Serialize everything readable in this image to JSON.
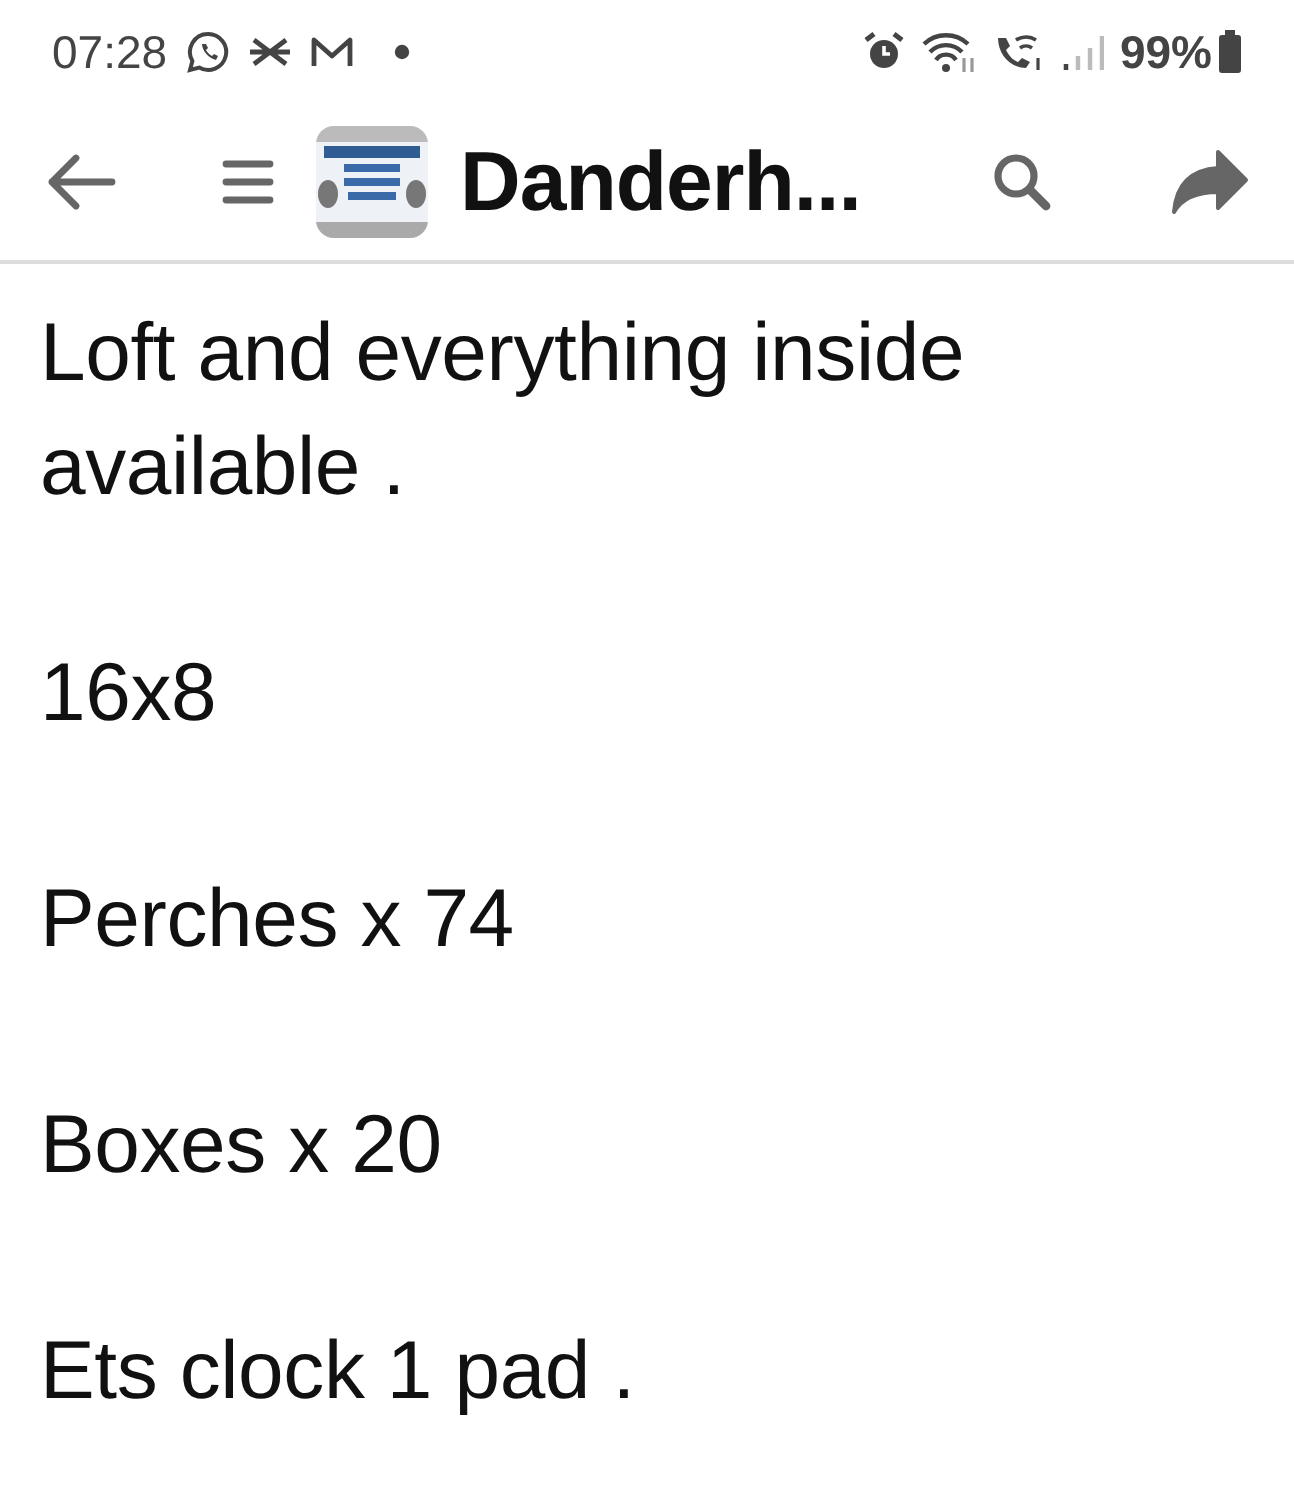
{
  "status_bar": {
    "time": "07:28",
    "battery": "99%"
  },
  "header": {
    "title": "Danderh..."
  },
  "post": {
    "paragraphs": [
      "Loft and everything inside available .",
      "16x8",
      "Perches x 74",
      "Boxes x 20",
      "Ets clock 1 pad ."
    ]
  }
}
